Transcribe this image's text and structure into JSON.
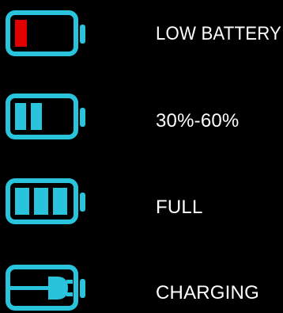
{
  "colors": {
    "background": "#000000",
    "battery_outline": "#29c4dc",
    "battery_fill": "#29c4dc",
    "low_level": "#e00000",
    "text": "#ffffff"
  },
  "statuses": [
    {
      "label": "LOW BATTERY",
      "icon": "battery-low-icon",
      "fill_bars": 1
    },
    {
      "label": "30%-60%",
      "icon": "battery-medium-icon",
      "fill_bars": 2
    },
    {
      "label": "FULL",
      "icon": "battery-full-icon",
      "fill_bars": 3
    },
    {
      "label": "CHARGING",
      "icon": "battery-charging-icon",
      "fill_bars": 0
    }
  ]
}
